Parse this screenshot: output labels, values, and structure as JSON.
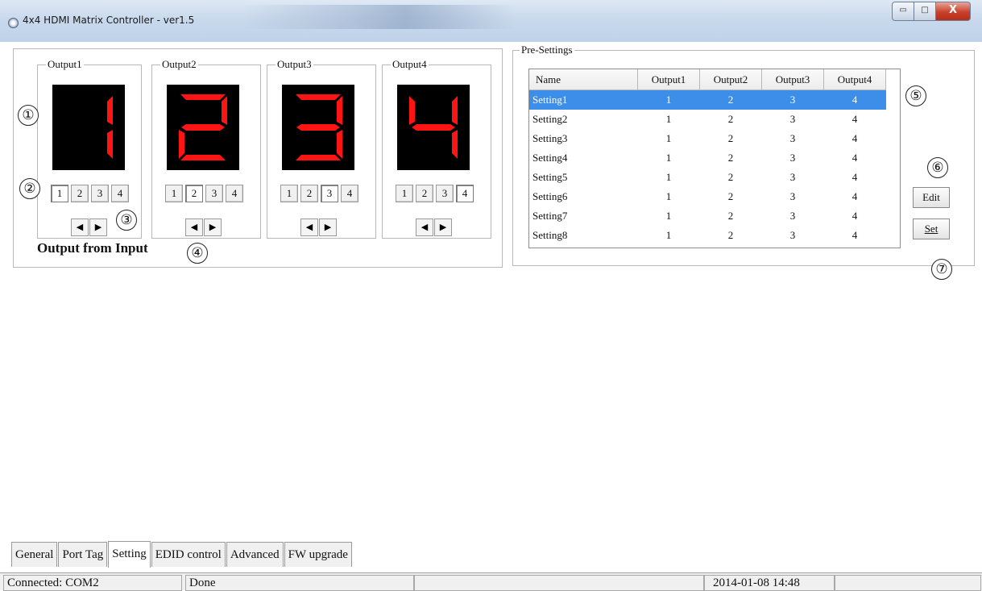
{
  "window": {
    "title": "4x4 HDMI Matrix Controller - ver1.5",
    "close_glyph": "X",
    "min_glyph": "▭",
    "max_glyph": "□"
  },
  "outputs": [
    {
      "label": "Output1",
      "digit": 1,
      "buttons": [
        "1",
        "2",
        "3",
        "4"
      ],
      "selected": 1
    },
    {
      "label": "Output2",
      "digit": 2,
      "buttons": [
        "1",
        "2",
        "3",
        "4"
      ],
      "selected": 2
    },
    {
      "label": "Output3",
      "digit": 3,
      "buttons": [
        "1",
        "2",
        "3",
        "4"
      ],
      "selected": 3
    },
    {
      "label": "Output4",
      "digit": 4,
      "buttons": [
        "1",
        "2",
        "3",
        "4"
      ],
      "selected": 4
    }
  ],
  "arrows": {
    "left": "◀",
    "right": "▶"
  },
  "output_from_input": "Output from Input",
  "markers": [
    "①",
    "②",
    "③",
    "④",
    "⑤",
    "⑥",
    "⑦"
  ],
  "presettings": {
    "label": "Pre-Settings",
    "columns": [
      "Name",
      "Output1",
      "Output2",
      "Output3",
      "Output4"
    ],
    "rows": [
      [
        "Setting1",
        "1",
        "2",
        "3",
        "4"
      ],
      [
        "Setting2",
        "1",
        "2",
        "3",
        "4"
      ],
      [
        "Setting3",
        "1",
        "2",
        "3",
        "4"
      ],
      [
        "Setting4",
        "1",
        "2",
        "3",
        "4"
      ],
      [
        "Setting5",
        "1",
        "2",
        "3",
        "4"
      ],
      [
        "Setting6",
        "1",
        "2",
        "3",
        "4"
      ],
      [
        "Setting7",
        "1",
        "2",
        "3",
        "4"
      ],
      [
        "Setting8",
        "1",
        "2",
        "3",
        "4"
      ]
    ],
    "selected_row": 0,
    "edit_label": "Edit",
    "set_label": "Set"
  },
  "bottom_tabs": [
    "General",
    "Port Tag",
    "Setting",
    "EDID control",
    "Advanced",
    "FW upgrade"
  ],
  "active_tab": "Setting",
  "status": {
    "connection": "Connected: COM2",
    "message": "Done",
    "datetime": "2014-01-08 14:48"
  },
  "colors": {
    "segment_on": "#ff1414",
    "display_bg": "#000000",
    "selection": "#3d8ee8"
  }
}
